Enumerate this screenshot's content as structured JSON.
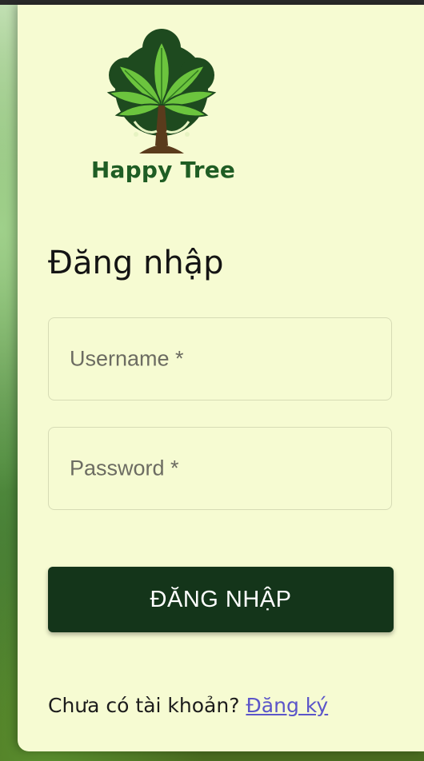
{
  "brand": {
    "name": "Happy Tree"
  },
  "form": {
    "title": "Đăng nhập",
    "username_label": "Username *",
    "password_label": "Password *",
    "submit_label": "ĐĂNG NHẬP"
  },
  "footer": {
    "prompt": "Chưa có tài khoản?",
    "register_link": "Đăng ký"
  },
  "colors": {
    "card_background": "#f6fbd2",
    "button_background": "#14351a",
    "brand_green": "#1f5d24",
    "link": "#5b55c9"
  }
}
